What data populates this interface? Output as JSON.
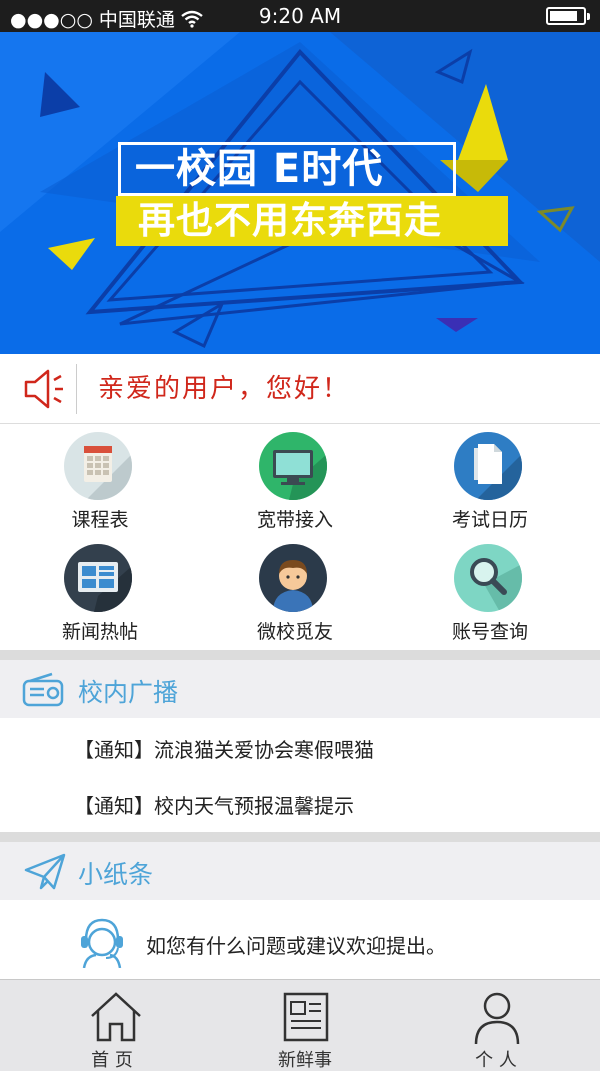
{
  "status_bar": {
    "carrier": "●●●○○ 中国联通",
    "time": "9:20 AM",
    "battery_level_percent": 85,
    "wifi_icon": "wifi-icon"
  },
  "banner": {
    "line1": "一校园  E时代",
    "line2": "再也不用东奔西走",
    "background_color": "#0a6ce8",
    "accent_color": "#eadb0c"
  },
  "notice": {
    "icon": "speaker-icon",
    "text": "亲爱的用户，您好！",
    "text_color": "#d0271b"
  },
  "features": [
    {
      "label": "课程表",
      "icon": "calendar-icon"
    },
    {
      "label": "宽带接入",
      "icon": "monitor-icon"
    },
    {
      "label": "考试日历",
      "icon": "document-icon"
    },
    {
      "label": "新闻热帖",
      "icon": "newspaper-icon"
    },
    {
      "label": "微校觅友",
      "icon": "person-icon"
    },
    {
      "label": "账号查询",
      "icon": "magnifier-icon"
    }
  ],
  "broadcast": {
    "title": "校内广播",
    "icon": "radio-icon",
    "items": [
      "【通知】流浪猫关爱协会寒假喂猫",
      "【通知】校内天气预报温馨提示"
    ]
  },
  "notes": {
    "title": "小纸条",
    "icon": "paper-plane-icon",
    "tip": "如您有什么问题或建议欢迎提出。",
    "tip_icon": "customer-service-icon"
  },
  "tabbar": [
    {
      "label": "首 页",
      "icon": "home-icon"
    },
    {
      "label": "新鲜事",
      "icon": "news-icon"
    },
    {
      "label": "个 人",
      "icon": "user-icon"
    }
  ],
  "accent_blue": "#4ea4d8"
}
